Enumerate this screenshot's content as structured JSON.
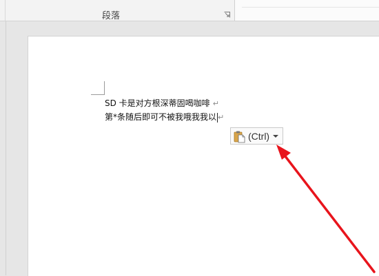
{
  "ribbon": {
    "group_label": "段落"
  },
  "document": {
    "line1": "SD 卡是对方根深蒂固喝咖啡",
    "line2": "第*条随后即可不被我哦我我以",
    "paragraph_mark": "↵"
  },
  "paste_options": {
    "label": "(Ctrl)"
  },
  "annotation": {
    "arrow_color": "#e8141c"
  }
}
